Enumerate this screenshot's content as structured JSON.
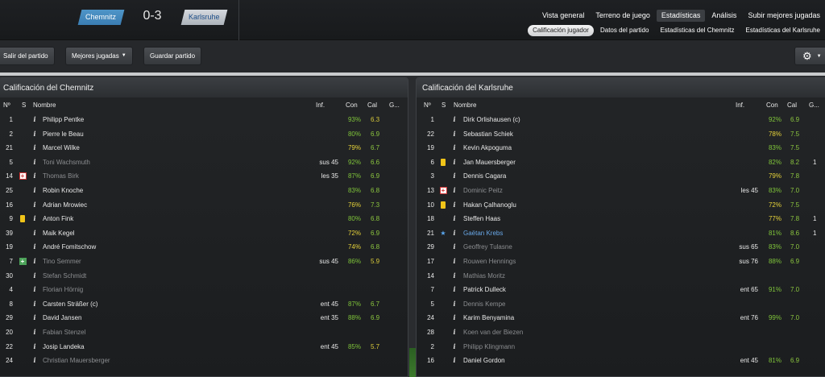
{
  "header": {
    "home_team": "Chemnitz",
    "away_team": "Karlsruhe",
    "score": "0-3",
    "top_tabs": [
      "Vista general",
      "Terreno de juego",
      "Estadísticas",
      "Análisis",
      "Subir mejores jugadas"
    ],
    "active_top_tab": "Estadísticas",
    "sub_tabs": [
      "Calificación jugador",
      "Datos del partido",
      "Estadísticas del Chemnitz",
      "Estadísticas del Karlsruhe"
    ],
    "active_sub_tab": "Calificación jugador"
  },
  "toolbar": {
    "leave_label": "Salir del partido",
    "highlights_label": "Mejores jugadas",
    "save_label": "Guardar partido",
    "gear_icon": "gear-icon"
  },
  "columns": {
    "num": "Nº",
    "s": "S",
    "name": "Nombre",
    "inf": "Inf.",
    "con": "Con",
    "cal": "Cal",
    "g": "G..."
  },
  "colors": {
    "home_badge": "#4a8fc4",
    "away_badge": "#c6cbd1",
    "con_green": "#7fc43a",
    "con_yellow": "#e6d33a",
    "yellow_card": "#f0c419"
  },
  "home": {
    "title": "Calificación del Chemnitz",
    "players": [
      {
        "num": "1",
        "flag": "",
        "name": "Philipp Pentke",
        "inf": "",
        "con": "93%",
        "cal": "6.3",
        "g": "",
        "dim": false
      },
      {
        "num": "2",
        "flag": "",
        "name": "Pierre le Beau",
        "inf": "",
        "con": "80%",
        "cal": "6.9",
        "g": "",
        "dim": false
      },
      {
        "num": "21",
        "flag": "",
        "name": "Marcel Wilke",
        "inf": "",
        "con": "79%",
        "cal": "6.7",
        "g": "",
        "dim": false
      },
      {
        "num": "5",
        "flag": "",
        "name": "Toni Wachsmuth",
        "inf": "sus 45",
        "con": "92%",
        "cal": "6.6",
        "g": "",
        "dim": true
      },
      {
        "num": "14",
        "flag": "injury",
        "name": "Thomas Birk",
        "inf": "les 35",
        "con": "87%",
        "cal": "6.9",
        "g": "",
        "dim": true
      },
      {
        "num": "25",
        "flag": "",
        "name": "Robin Knoche",
        "inf": "",
        "con": "83%",
        "cal": "6.8",
        "g": "",
        "dim": false
      },
      {
        "num": "16",
        "flag": "",
        "name": "Adrian Mrowiec",
        "inf": "",
        "con": "76%",
        "cal": "7.3",
        "g": "",
        "dim": false
      },
      {
        "num": "9",
        "flag": "yellow",
        "name": "Anton Fink",
        "inf": "",
        "con": "80%",
        "cal": "6.8",
        "g": "",
        "dim": false
      },
      {
        "num": "39",
        "flag": "",
        "name": "Maik Kegel",
        "inf": "",
        "con": "72%",
        "cal": "6.9",
        "g": "",
        "dim": false
      },
      {
        "num": "19",
        "flag": "",
        "name": "André Fomitschow",
        "inf": "",
        "con": "74%",
        "cal": "6.8",
        "g": "",
        "dim": false
      },
      {
        "num": "7",
        "flag": "sub",
        "name": "Tino Semmer",
        "inf": "sus 45",
        "con": "86%",
        "cal": "5.9",
        "g": "",
        "dim": true
      },
      {
        "num": "30",
        "flag": "",
        "name": "Stefan Schmidt",
        "inf": "",
        "con": "",
        "cal": "",
        "g": "",
        "dim": true
      },
      {
        "num": "4",
        "flag": "",
        "name": "Florian Hörnig",
        "inf": "",
        "con": "",
        "cal": "",
        "g": "",
        "dim": true
      },
      {
        "num": "8",
        "flag": "",
        "name": "Carsten Sträßer (c)",
        "inf": "ent 45",
        "con": "87%",
        "cal": "6.7",
        "g": "",
        "dim": false
      },
      {
        "num": "29",
        "flag": "",
        "name": "David Jansen",
        "inf": "ent 35",
        "con": "88%",
        "cal": "6.9",
        "g": "",
        "dim": false
      },
      {
        "num": "20",
        "flag": "",
        "name": "Fabian Stenzel",
        "inf": "",
        "con": "",
        "cal": "",
        "g": "",
        "dim": true
      },
      {
        "num": "22",
        "flag": "",
        "name": "Josip Landeka",
        "inf": "ent 45",
        "con": "85%",
        "cal": "5.7",
        "g": "",
        "dim": false
      },
      {
        "num": "24",
        "flag": "",
        "name": "Christian Mauersberger",
        "inf": "",
        "con": "",
        "cal": "",
        "g": "",
        "dim": true
      }
    ]
  },
  "away": {
    "title": "Calificación del Karlsruhe",
    "players": [
      {
        "num": "1",
        "flag": "",
        "name": "Dirk Orlishausen (c)",
        "inf": "",
        "con": "92%",
        "cal": "6.9",
        "g": "",
        "dim": false
      },
      {
        "num": "22",
        "flag": "",
        "name": "Sebastian Schiek",
        "inf": "",
        "con": "78%",
        "cal": "7.5",
        "g": "",
        "dim": false
      },
      {
        "num": "19",
        "flag": "",
        "name": "Kevin Akpoguma",
        "inf": "",
        "con": "83%",
        "cal": "7.5",
        "g": "",
        "dim": false
      },
      {
        "num": "6",
        "flag": "yellow",
        "name": "Jan Mauersberger",
        "inf": "",
        "con": "82%",
        "cal": "8.2",
        "g": "1",
        "dim": false
      },
      {
        "num": "3",
        "flag": "",
        "name": "Dennis Cagara",
        "inf": "",
        "con": "79%",
        "cal": "7.8",
        "g": "",
        "dim": false
      },
      {
        "num": "13",
        "flag": "injury",
        "name": "Dominic Peitz",
        "inf": "les 45",
        "con": "83%",
        "cal": "7.0",
        "g": "",
        "dim": true
      },
      {
        "num": "10",
        "flag": "yellow",
        "name": "Hakan Çalhanoglu",
        "inf": "",
        "con": "72%",
        "cal": "7.5",
        "g": "",
        "dim": false
      },
      {
        "num": "18",
        "flag": "",
        "name": "Steffen Haas",
        "inf": "",
        "con": "77%",
        "cal": "7.8",
        "g": "1",
        "dim": false
      },
      {
        "num": "21",
        "flag": "star",
        "name": "Gaëtan Krebs",
        "inf": "",
        "con": "81%",
        "cal": "8.6",
        "g": "1",
        "dim": false,
        "star": true
      },
      {
        "num": "29",
        "flag": "",
        "name": "Geoffrey Tulasne",
        "inf": "sus 65",
        "con": "83%",
        "cal": "7.0",
        "g": "",
        "dim": true
      },
      {
        "num": "17",
        "flag": "",
        "name": "Rouwen Hennings",
        "inf": "sus 76",
        "con": "88%",
        "cal": "6.9",
        "g": "",
        "dim": true
      },
      {
        "num": "14",
        "flag": "",
        "name": "Mathias Moritz",
        "inf": "",
        "con": "",
        "cal": "",
        "g": "",
        "dim": true
      },
      {
        "num": "7",
        "flag": "",
        "name": "Patrick Dulleck",
        "inf": "ent 65",
        "con": "91%",
        "cal": "7.0",
        "g": "",
        "dim": false
      },
      {
        "num": "5",
        "flag": "",
        "name": "Dennis Kempe",
        "inf": "",
        "con": "",
        "cal": "",
        "g": "",
        "dim": true
      },
      {
        "num": "24",
        "flag": "",
        "name": "Karim Benyamina",
        "inf": "ent 76",
        "con": "99%",
        "cal": "7.0",
        "g": "",
        "dim": false
      },
      {
        "num": "28",
        "flag": "",
        "name": "Koen van der Biezen",
        "inf": "",
        "con": "",
        "cal": "",
        "g": "",
        "dim": true
      },
      {
        "num": "2",
        "flag": "",
        "name": "Philipp Klingmann",
        "inf": "",
        "con": "",
        "cal": "",
        "g": "",
        "dim": true
      },
      {
        "num": "16",
        "flag": "",
        "name": "Daniel Gordon",
        "inf": "ent 45",
        "con": "81%",
        "cal": "6.9",
        "g": "",
        "dim": false
      }
    ]
  }
}
